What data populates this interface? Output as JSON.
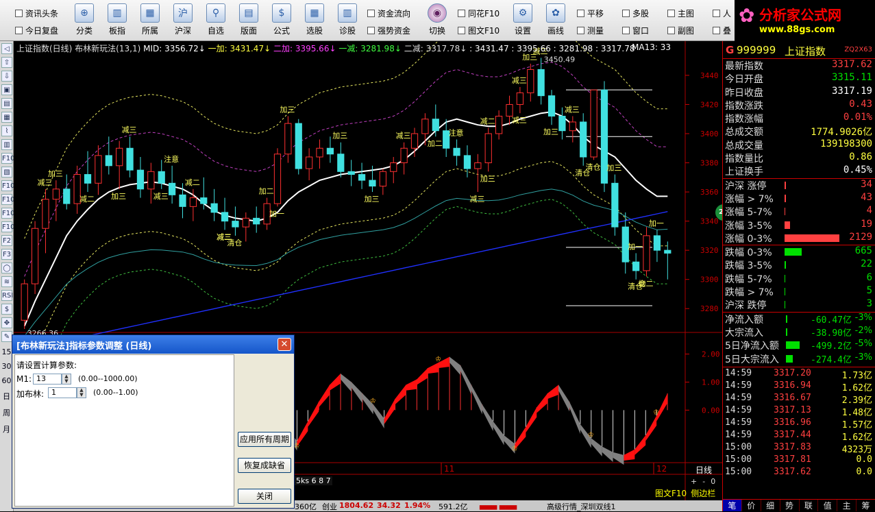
{
  "toolbar": {
    "checks_left": [
      "资讯头条",
      "今日复盘"
    ],
    "buttons": [
      "分类",
      "板指",
      "所属",
      "沪深",
      "自选",
      "版面",
      "公式",
      "选股",
      "诊股"
    ],
    "checks_mid": [
      "资金流向",
      "强势资金"
    ],
    "switch_button": "切换",
    "checks_mid2": [
      "同花F10",
      "图文F10"
    ],
    "buttons2": [
      "设置",
      "画线"
    ],
    "checks_right": [
      "平移",
      "多股",
      "主图",
      "人",
      "测量",
      "窗口",
      "副图",
      "叠"
    ],
    "icon_glyphs": [
      "⊕",
      "▥",
      "▦",
      "沪",
      "⚲",
      "▤",
      "$",
      "▦",
      "▥",
      "◉",
      "⚙",
      "✿"
    ]
  },
  "logo": {
    "title": "分析家公式网",
    "url": "www.88gs.com"
  },
  "chart": {
    "info": {
      "name": "上证指数(日线) 布林新玩法(13,1)",
      "mid": "MID: 3356.72↓",
      "yijia": "一加: 3431.47↓",
      "erjia": "二加: 3395.66↓",
      "yijian": "一减: 3281.98↓",
      "erjian": "二减: 3317.78↓",
      "rest": ": 3431.47 : 3395.66 : 3281.98 : 3317.78",
      "ma": "MA13: 33"
    },
    "high_label": "3450.49",
    "low_label": "3266.36",
    "y_ticks": [
      "3440",
      "3420",
      "3400",
      "3380",
      "3360",
      "3340",
      "3320",
      "3300",
      "3280"
    ],
    "sub_ticks": [
      "2.00",
      "1.00",
      "0.00"
    ],
    "date_labels": [
      "11",
      "12"
    ],
    "period_label": "日线",
    "bottom_tabs": "5ks 6 8 7",
    "bottom_right": [
      "图文F10",
      "侧边栏"
    ],
    "zoom_controls": [
      "+",
      "-",
      "0"
    ],
    "badge": "26",
    "signals": [
      {
        "t": "减三"
      },
      {
        "t": "减二"
      },
      {
        "t": "减三"
      },
      {
        "t": "减三"
      },
      {
        "t": "减二"
      },
      {
        "t": "减三"
      },
      {
        "t": "加三"
      },
      {
        "t": "加三"
      },
      {
        "t": "注意"
      },
      {
        "t": "减二"
      },
      {
        "t": "加三"
      },
      {
        "t": "清仓"
      },
      {
        "t": "加二"
      },
      {
        "t": "加一"
      },
      {
        "t": "加三"
      },
      {
        "t": "加三"
      },
      {
        "t": "减三"
      },
      {
        "t": "加二"
      },
      {
        "t": "减二"
      },
      {
        "t": "加三"
      },
      {
        "t": "注意"
      },
      {
        "t": "减三"
      },
      {
        "t": "减三"
      },
      {
        "t": "清仓"
      },
      {
        "t": "加三"
      },
      {
        "t": "加三"
      },
      {
        "t": "减三"
      },
      {
        "t": "清仓"
      },
      {
        "t": "减三"
      },
      {
        "t": "减三"
      },
      {
        "t": "加三"
      },
      {
        "t": "加二"
      },
      {
        "t": "加一"
      },
      {
        "t": "清仓"
      },
      {
        "t": "加一"
      },
      {
        "t": "仓"
      }
    ]
  },
  "chart_data": {
    "type": "candlestick",
    "title": "上证指数(日线) 布林新玩法(13,1)",
    "ylim": [
      3266,
      3455
    ],
    "sub_ylim": [
      -1.8,
      2.6
    ],
    "ohlc": [
      [
        3272,
        3300,
        3266,
        3297
      ],
      [
        3297,
        3340,
        3290,
        3335
      ],
      [
        3335,
        3362,
        3318,
        3355
      ],
      [
        3355,
        3368,
        3340,
        3362
      ],
      [
        3362,
        3372,
        3348,
        3352
      ],
      [
        3352,
        3378,
        3345,
        3372
      ],
      [
        3372,
        3388,
        3360,
        3366
      ],
      [
        3366,
        3392,
        3358,
        3385
      ],
      [
        3385,
        3398,
        3372,
        3378
      ],
      [
        3378,
        3395,
        3362,
        3390
      ],
      [
        3390,
        3398,
        3370,
        3375
      ],
      [
        3375,
        3384,
        3356,
        3362
      ],
      [
        3362,
        3380,
        3352,
        3374
      ],
      [
        3374,
        3382,
        3362,
        3366
      ],
      [
        3366,
        3378,
        3352,
        3358
      ],
      [
        3358,
        3366,
        3342,
        3350
      ],
      [
        3350,
        3362,
        3340,
        3356
      ],
      [
        3356,
        3370,
        3348,
        3352
      ],
      [
        3352,
        3362,
        3340,
        3346
      ],
      [
        3346,
        3356,
        3334,
        3340
      ],
      [
        3340,
        3350,
        3330,
        3336
      ],
      [
        3336,
        3346,
        3326,
        3342
      ],
      [
        3342,
        3350,
        3332,
        3338
      ],
      [
        3338,
        3356,
        3334,
        3352
      ],
      [
        3352,
        3390,
        3350,
        3386
      ],
      [
        3386,
        3412,
        3380,
        3407
      ],
      [
        3407,
        3410,
        3372,
        3376
      ],
      [
        3376,
        3390,
        3368,
        3384
      ],
      [
        3384,
        3396,
        3376,
        3390
      ],
      [
        3390,
        3398,
        3380,
        3386
      ],
      [
        3386,
        3394,
        3370,
        3374
      ],
      [
        3374,
        3382,
        3364,
        3372
      ],
      [
        3372,
        3380,
        3362,
        3368
      ],
      [
        3368,
        3378,
        3360,
        3364
      ],
      [
        3364,
        3376,
        3358,
        3374
      ],
      [
        3374,
        3384,
        3366,
        3380
      ],
      [
        3380,
        3394,
        3372,
        3390
      ],
      [
        3390,
        3404,
        3384,
        3400
      ],
      [
        3400,
        3414,
        3392,
        3410
      ],
      [
        3410,
        3420,
        3398,
        3402
      ],
      [
        3402,
        3410,
        3384,
        3390
      ],
      [
        3390,
        3396,
        3378,
        3385
      ],
      [
        3385,
        3392,
        3370,
        3376
      ],
      [
        3376,
        3386,
        3360,
        3380
      ],
      [
        3380,
        3404,
        3374,
        3400
      ],
      [
        3400,
        3416,
        3396,
        3412
      ],
      [
        3412,
        3426,
        3406,
        3420
      ],
      [
        3420,
        3432,
        3414,
        3428
      ],
      [
        3428,
        3448,
        3422,
        3444
      ],
      [
        3444,
        3452,
        3420,
        3426
      ],
      [
        3426,
        3430,
        3406,
        3412
      ],
      [
        3412,
        3418,
        3396,
        3402
      ],
      [
        3402,
        3412,
        3394,
        3408
      ],
      [
        3408,
        3414,
        3378,
        3384
      ],
      [
        3384,
        3424,
        3382,
        3430
      ],
      [
        3430,
        3436,
        3360,
        3366
      ],
      [
        3366,
        3372,
        3330,
        3336
      ],
      [
        3336,
        3346,
        3304,
        3312
      ],
      [
        3312,
        3318,
        3300,
        3306
      ],
      [
        3306,
        3336,
        3302,
        3330
      ],
      [
        3330,
        3334,
        3312,
        3320
      ],
      [
        3320,
        3326,
        3300,
        3318
      ]
    ],
    "mid_line": [
      3268,
      3285,
      3300,
      3315,
      3330,
      3340,
      3348,
      3355,
      3360,
      3363,
      3365,
      3366,
      3367,
      3366,
      3364,
      3362,
      3358,
      3352,
      3347,
      3344,
      3342,
      3341,
      3340,
      3342,
      3346,
      3354,
      3360,
      3364,
      3368,
      3370,
      3372,
      3373,
      3374,
      3375,
      3376,
      3378,
      3382,
      3388,
      3395,
      3402,
      3408,
      3410,
      3408,
      3406,
      3405,
      3405,
      3407,
      3410,
      3412,
      3414,
      3415,
      3412,
      3406,
      3398,
      3392,
      3388,
      3384,
      3376,
      3368,
      3362,
      3357,
      3357
    ],
    "sub_line": [
      0.8,
      1.2,
      1.5,
      1.3,
      1.0,
      0.6,
      0.9,
      1.4,
      1.1,
      0.7,
      0.2,
      -0.4,
      0.3,
      1.1,
      1.5,
      0.9,
      0.2,
      -0.3,
      0.4,
      0.9,
      1.2,
      0.8,
      0.5,
      0.1,
      -0.6,
      -1.1,
      -0.4,
      0.3,
      0.9,
      1.3,
      1.0,
      0.6,
      0.2,
      -0.3,
      0.4,
      0.9,
      1.1,
      1.5,
      1.7,
      1.9,
      1.6,
      0.9,
      0.2,
      -0.4,
      -0.9,
      -1.2,
      -0.6,
      0.1,
      0.6,
      0.9,
      0.3,
      -0.5,
      -1.0,
      -1.3,
      -1.5,
      -1.6,
      -1.4,
      -0.9,
      -0.2,
      0.6
    ]
  },
  "right_panel": {
    "code": "999999",
    "name": "上证指数",
    "tag": "ZQ2X63",
    "g": "G",
    "quote": [
      {
        "l": "最新指数",
        "v": "3317.62",
        "c": "#ff4040"
      },
      {
        "l": "今日开盘",
        "v": "3315.11",
        "c": "#00e000"
      },
      {
        "l": "昨日收盘",
        "v": "3317.19",
        "c": "#fff"
      },
      {
        "l": "指数涨跌",
        "v": "0.43",
        "c": "#ff4040"
      },
      {
        "l": "指数涨幅",
        "v": "0.01%",
        "c": "#ff4040"
      },
      {
        "l": "总成交额",
        "v": "1774.9026亿",
        "c": "#ffff40"
      },
      {
        "l": "总成交量",
        "v": "139198300",
        "c": "#ffff40"
      },
      {
        "l": "指数量比",
        "v": "0.86",
        "c": "#ffff40"
      },
      {
        "l": "上证换手",
        "v": "0.45%",
        "c": "#fff"
      }
    ],
    "breadth_up": [
      {
        "l": "沪深 涨停",
        "v": "34",
        "c": "#ff4040",
        "bar": 2
      },
      {
        "l": "涨幅 > 7%",
        "v": "43",
        "c": "#ff4040",
        "bar": 2
      },
      {
        "l": "涨幅 5-7%",
        "v": "4",
        "c": "#ff4040",
        "bar": 1
      },
      {
        "l": "涨幅 3-5%",
        "v": "19",
        "c": "#ff4040",
        "bar": 8
      },
      {
        "l": "涨幅 0-3%",
        "v": "2129",
        "c": "#ff4040",
        "bar": 80
      }
    ],
    "breadth_down": [
      {
        "l": "跌幅 0-3%",
        "v": "665",
        "c": "#00e000",
        "bar": 25
      },
      {
        "l": "跌幅 3-5%",
        "v": "22",
        "c": "#00e000",
        "bar": 2
      },
      {
        "l": "跌幅 5-7%",
        "v": "6",
        "c": "#00e000",
        "bar": 1
      },
      {
        "l": "跌幅 > 7%",
        "v": "5",
        "c": "#00e000",
        "bar": 1
      },
      {
        "l": "沪深 跌停",
        "v": "3",
        "c": "#00e000",
        "bar": 1
      }
    ],
    "flows": [
      {
        "l": "净流入额",
        "v": "-60.47亿",
        "p": "-3%",
        "bar": 2
      },
      {
        "l": "大宗流入",
        "v": "-38.90亿",
        "p": "-2%",
        "bar": 2
      },
      {
        "l": "5日净流入额",
        "v": "-499.2亿",
        "p": "-5%",
        "bar": 20
      },
      {
        "l": "5日大宗流入",
        "v": "-274.4亿",
        "p": "-3%",
        "bar": 10
      }
    ],
    "ticks": [
      {
        "t": "14:59",
        "p": "3317.20",
        "pc": "#ff4040",
        "v": "1.73亿"
      },
      {
        "t": "14:59",
        "p": "3316.94",
        "pc": "#ff4040",
        "v": "1.62亿"
      },
      {
        "t": "14:59",
        "p": "3316.67",
        "pc": "#ff4040",
        "v": "2.39亿"
      },
      {
        "t": "14:59",
        "p": "3317.13",
        "pc": "#ff4040",
        "v": "1.48亿"
      },
      {
        "t": "14:59",
        "p": "3316.96",
        "pc": "#ff4040",
        "v": "1.57亿"
      },
      {
        "t": "14:59",
        "p": "3317.44",
        "pc": "#ff4040",
        "v": "1.62亿"
      },
      {
        "t": "15:00",
        "p": "3317.83",
        "pc": "#ff4040",
        "v": "4323万"
      },
      {
        "t": "15:00",
        "p": "3317.81",
        "pc": "#ff4040",
        "v": "0.0"
      },
      {
        "t": "15:00",
        "p": "3317.62",
        "pc": "#ff4040",
        "v": "0.0"
      }
    ],
    "tabs": [
      "笔",
      "价",
      "细",
      "势",
      "联",
      "值",
      "主",
      "筹"
    ]
  },
  "status": {
    "a": "360亿",
    "b_label": "创业",
    "b_val": "1804.62",
    "b_chg": "34.32",
    "b_pct": "1.94%",
    "c": "591.2亿",
    "d": "高级行情_深圳双线1"
  },
  "dialog": {
    "title": "[布林新玩法]指标参数调整 (日线)",
    "prompt": "请设置计算参数:",
    "p1_label": "M1:",
    "p1_value": "13",
    "p1_range": "(0.00--1000.00)",
    "p2_label": "加布林:",
    "p2_value": "1",
    "p2_range": "(0.00--1.00)",
    "apply_all": "应用所有周期",
    "restore": "恢复成缺省",
    "close": "关闭",
    "close_x": "✕"
  },
  "left_toolbar": {
    "icons": [
      "◁",
      "⇧",
      "⇩",
      "▣",
      "▤",
      "▦",
      "⌇",
      "▥",
      "F10",
      "▧",
      "F10",
      "F10",
      "F10",
      "F10",
      "F2",
      "F3",
      "◯",
      "≋",
      "RSI",
      "$",
      "✥",
      "✎"
    ],
    "nums": [
      "15",
      "30",
      "60",
      "日",
      "周",
      "月"
    ]
  }
}
